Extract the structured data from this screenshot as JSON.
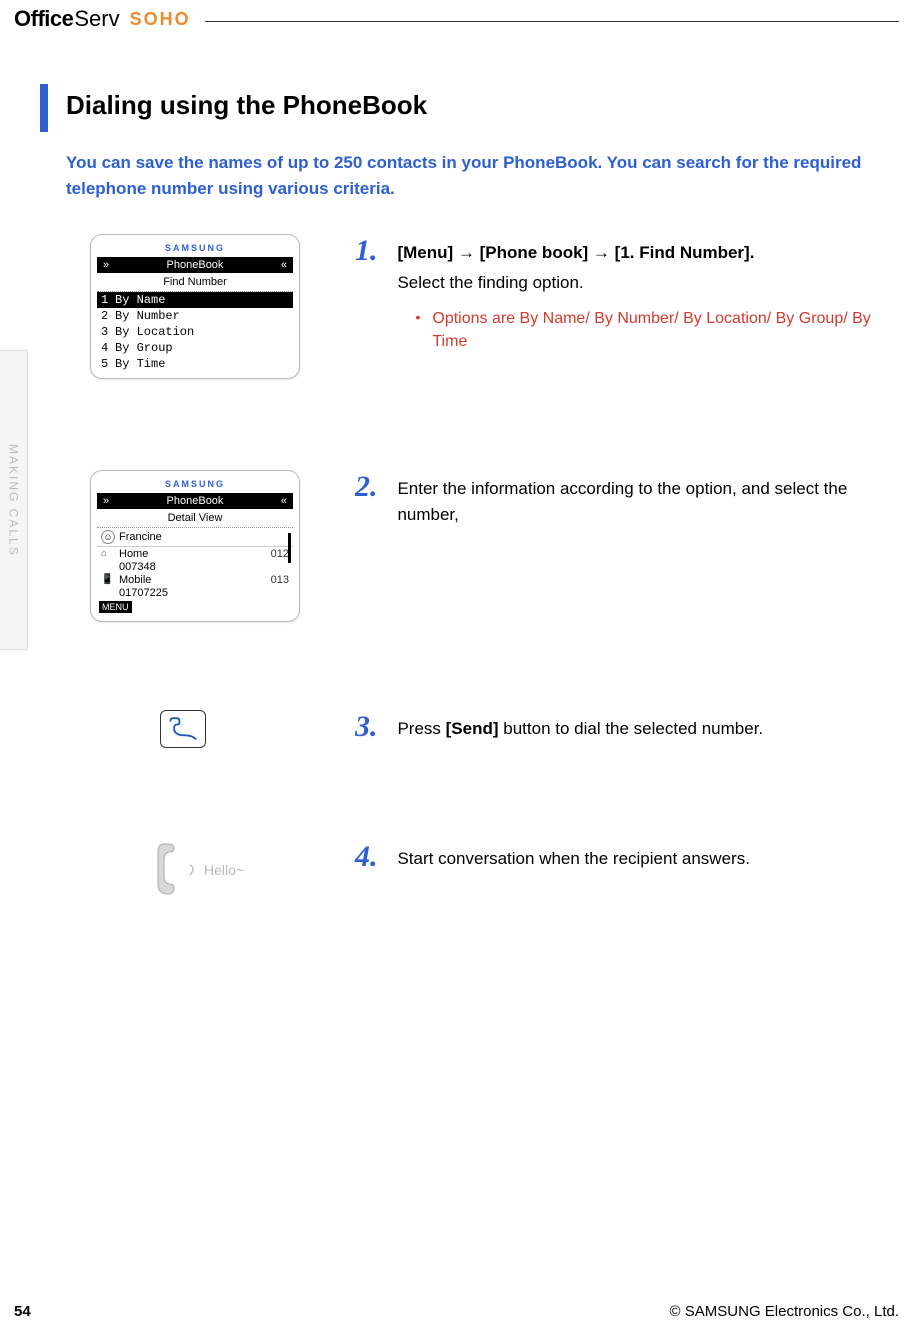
{
  "header": {
    "brand1": "Office",
    "brand2": "Serv",
    "brand3": "SOHO"
  },
  "sidebar": {
    "label": "MAKING CALLS"
  },
  "title": "Dialing using the PhoneBook",
  "subtitle": "You can save the names of up to 250 contacts in your PhoneBook. You can search for the required telephone number using various criteria.",
  "phone1": {
    "brand": "SAMSUNG",
    "titlebar_left": "»",
    "titlebar_center": "PhoneBook",
    "titlebar_right": "«",
    "subhead": "Find Number",
    "rows": [
      {
        "n": "1",
        "t": "By Name",
        "sel": true
      },
      {
        "n": "2",
        "t": "By Number"
      },
      {
        "n": "3",
        "t": "By Location"
      },
      {
        "n": "4",
        "t": "By Group"
      },
      {
        "n": "5",
        "t": "By Time"
      }
    ]
  },
  "phone2": {
    "brand": "SAMSUNG",
    "titlebar_left": "»",
    "titlebar_center": "PhoneBook",
    "titlebar_right": "«",
    "subhead": "Detail View",
    "name": "Francine",
    "home_label": "Home",
    "home_pre": "012",
    "home_num": "007348",
    "mobile_label": "Mobile",
    "mobile_pre": "013",
    "mobile_num": "01707225",
    "menu_label": "MENU"
  },
  "step1": {
    "num": "1.",
    "path": "[Menu] → [Phone book] → [1. Find Number].",
    "sub": "Select the finding option.",
    "bullet": "Options are By Name/ By Number/ By Location/ By Group/ By Time"
  },
  "step2": {
    "num": "2.",
    "text": "Enter the information according to the option, and select the number,"
  },
  "step3": {
    "num": "3.",
    "pre": "Press ",
    "bold": "[Send]",
    "post": " button to dial the selected number."
  },
  "step4": {
    "num": "4.",
    "text": "Start conversation when the recipient answers.",
    "hello": "Hello~"
  },
  "footer": {
    "page": "54",
    "copyright": "© SAMSUNG Electronics Co., Ltd."
  }
}
